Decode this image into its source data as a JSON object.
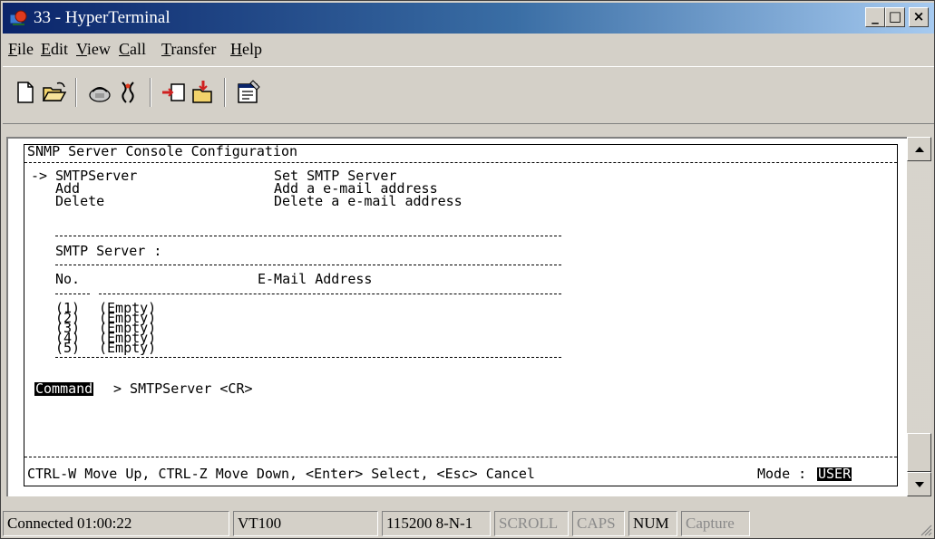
{
  "window": {
    "title": "33 - HyperTerminal",
    "title_gradient_start": "#0a246a",
    "title_gradient_end": "#a6caf0",
    "minimize_label": "_",
    "maximize_label": "□",
    "close_label": "×"
  },
  "menu": [
    {
      "accel": "F",
      "rest": "ile"
    },
    {
      "accel": "E",
      "rest": "dit"
    },
    {
      "accel": "V",
      "rest": "iew"
    },
    {
      "accel": "C",
      "rest": "all"
    },
    {
      "accel": "T",
      "rest": "ransfer"
    },
    {
      "accel": "H",
      "rest": "elp"
    }
  ],
  "toolbar": {
    "icons": [
      "new-icon",
      "open-icon",
      "connect-icon",
      "disconnect-icon",
      "send-icon",
      "receive-icon",
      "properties-icon"
    ]
  },
  "console": {
    "header": "SNMP Server Console Configuration",
    "menu_arrow": "->",
    "options": [
      {
        "name": "SMTPServer",
        "desc": "Set SMTP Server"
      },
      {
        "name": "Add",
        "desc": "Add a e-mail address"
      },
      {
        "name": "Delete",
        "desc": "Delete a e-mail address"
      }
    ],
    "smtp_label": "SMTP Server :",
    "col_no": "No.",
    "col_email": "E-Mail Address",
    "entries": [
      {
        "no": "(1)",
        "value": "(Empty)"
      },
      {
        "no": "(2)",
        "value": "(Empty)"
      },
      {
        "no": "(3)",
        "value": "(Empty)"
      },
      {
        "no": "(4)",
        "value": "(Empty)"
      },
      {
        "no": "(5)",
        "value": "(Empty)"
      }
    ],
    "command_label": "Command",
    "command_text": "> SMTPServer <CR>",
    "help_text": "CTRL-W Move Up, CTRL-Z Move Down, <Enter> Select, <Esc> Cancel",
    "mode_label": "Mode :",
    "mode_value": "USER"
  },
  "status": {
    "connected": "Connected 01:00:22",
    "emulation": "VT100",
    "port_settings": "115200 8-N-1",
    "scroll": "SCROLL",
    "caps": "CAPS",
    "num": "NUM",
    "capture": "Capture"
  }
}
